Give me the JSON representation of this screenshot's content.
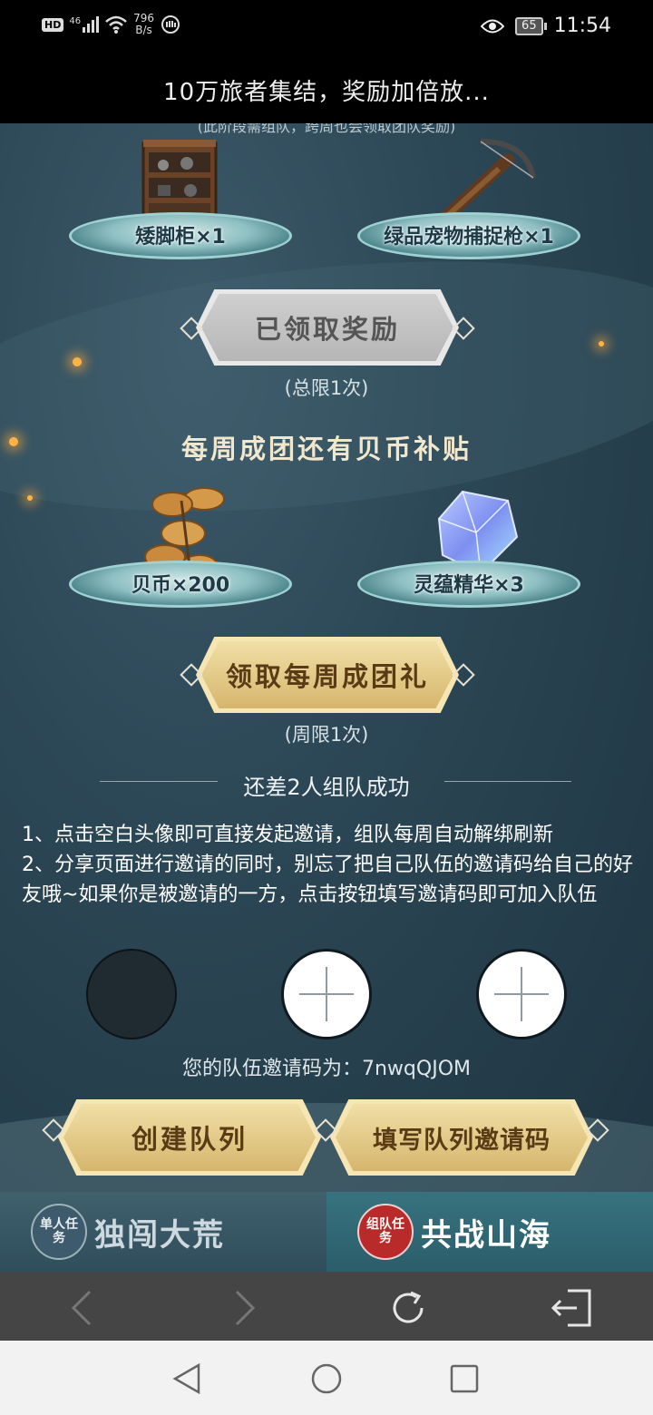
{
  "status_bar": {
    "hd": "HD",
    "signal": "46",
    "net_speed_value": "796",
    "net_speed_unit": "B/s",
    "battery": "65",
    "time": "11:54"
  },
  "page_title": "10万旅者集结，奖励加倍放...",
  "team_reward": {
    "cut_text": "(此阶段需组队，跨周也会领取团队奖励)",
    "items": [
      {
        "label": "矮脚柜×1",
        "icon": "cabinet-icon"
      },
      {
        "label": "绿品宠物捕捉枪×1",
        "icon": "crossbow-icon"
      }
    ],
    "button_label": "已领取奖励",
    "limit": "(总限1次)"
  },
  "weekly": {
    "title": "每周成团还有贝币补贴",
    "items": [
      {
        "label": "贝币×200",
        "icon": "shell-coin-icon"
      },
      {
        "label": "灵蕴精华×3",
        "icon": "crystal-icon"
      }
    ],
    "button_label": "领取每周成团礼",
    "limit": "(周限1次)"
  },
  "team": {
    "heading": "还差2人组队成功",
    "rules": [
      "1、点击空白头像即可直接发起邀请，组队每周自动解绑刷新",
      "2、分享页面进行邀请的同时，别忘了把自己队伍的邀请码给自己的好友哦~如果你是被邀请的一方，点击按钮填写邀请码即可加入队伍"
    ],
    "invite_code": "您的队伍邀请码为：7nwqQJOM",
    "create_button": "创建队列",
    "fill_button": "填写队列邀请码"
  },
  "tabs": [
    {
      "seal": "单人任务",
      "label": "独闯大荒",
      "active": false
    },
    {
      "seal": "组队任务",
      "label": "共战山海",
      "active": true
    }
  ],
  "colors": {
    "background": "#2c4756",
    "gold_button": "#e6c987",
    "gray_button": "#c4c4c4",
    "seal_red": "#b92a2a"
  }
}
